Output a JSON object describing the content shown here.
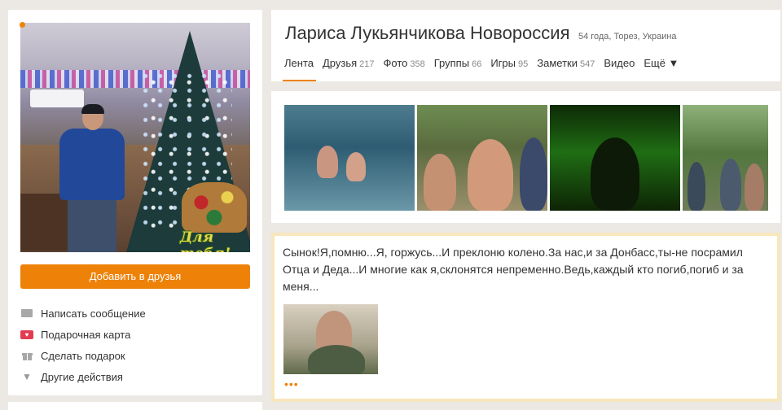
{
  "profile": {
    "name": "Лариса Лукьянчикова Новороссия",
    "meta": "54 года, Торез, Украина",
    "avatar_caption": "Для тебя!"
  },
  "left": {
    "add_friend_label": "Добавить в друзья",
    "actions": [
      {
        "label": "Написать сообщение",
        "icon": "envelope-icon"
      },
      {
        "label": "Подарочная карта",
        "icon": "gift-card-icon"
      },
      {
        "label": "Сделать подарок",
        "icon": "gift-icon"
      },
      {
        "label": "Другие действия",
        "icon": "chevron-down-icon"
      }
    ]
  },
  "tabs": [
    {
      "label": "Лента",
      "count": ""
    },
    {
      "label": "Друзья",
      "count": "217"
    },
    {
      "label": "Фото",
      "count": "358"
    },
    {
      "label": "Группы",
      "count": "66"
    },
    {
      "label": "Игры",
      "count": "95"
    },
    {
      "label": "Заметки",
      "count": "547"
    },
    {
      "label": "Видео",
      "count": ""
    },
    {
      "label": "Ещё ▼",
      "count": ""
    }
  ],
  "post": {
    "text": "Сынок!Я,помню...Я, горжусь...И преклоню колено.За нас,и за Донбасс,ты-не посрамил Отца и Деда...И многие как я,склонятся непременно.Ведь,каждый кто погиб,погиб и за меня...",
    "more": "•••"
  },
  "colors": {
    "accent": "#ee8208",
    "background": "#ece9e4",
    "post_border": "#f6e7bd"
  }
}
